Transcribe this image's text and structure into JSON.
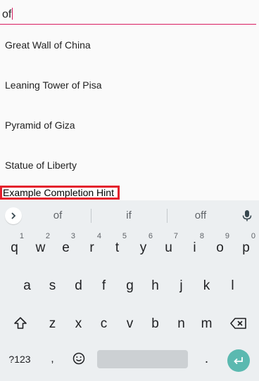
{
  "search": {
    "value": "of"
  },
  "suggestions": [
    "Great Wall of China",
    "Leaning Tower of Pisa",
    "Pyramid of Giza",
    "Statue of Liberty"
  ],
  "hint": "Example Completion Hint",
  "keyboard": {
    "word_suggestions": [
      "of",
      "if",
      "off"
    ],
    "row1": [
      {
        "k": "q",
        "n": "1"
      },
      {
        "k": "w",
        "n": "2"
      },
      {
        "k": "e",
        "n": "3"
      },
      {
        "k": "r",
        "n": "4"
      },
      {
        "k": "t",
        "n": "5"
      },
      {
        "k": "y",
        "n": "6"
      },
      {
        "k": "u",
        "n": "7"
      },
      {
        "k": "i",
        "n": "8"
      },
      {
        "k": "o",
        "n": "9"
      },
      {
        "k": "p",
        "n": "0"
      }
    ],
    "row2": [
      "a",
      "s",
      "d",
      "f",
      "g",
      "h",
      "j",
      "k",
      "l"
    ],
    "row3": [
      "z",
      "x",
      "c",
      "v",
      "b",
      "n",
      "m"
    ],
    "symbols_label": "?123",
    "comma": ",",
    "period": ".",
    "accent_color": "#5bb9b0",
    "icons": {
      "expand": "chevron-right-icon",
      "mic": "mic-icon",
      "shift": "shift-icon",
      "backspace": "backspace-icon",
      "emoji": "emoji-icon",
      "enter": "enter-icon"
    }
  }
}
